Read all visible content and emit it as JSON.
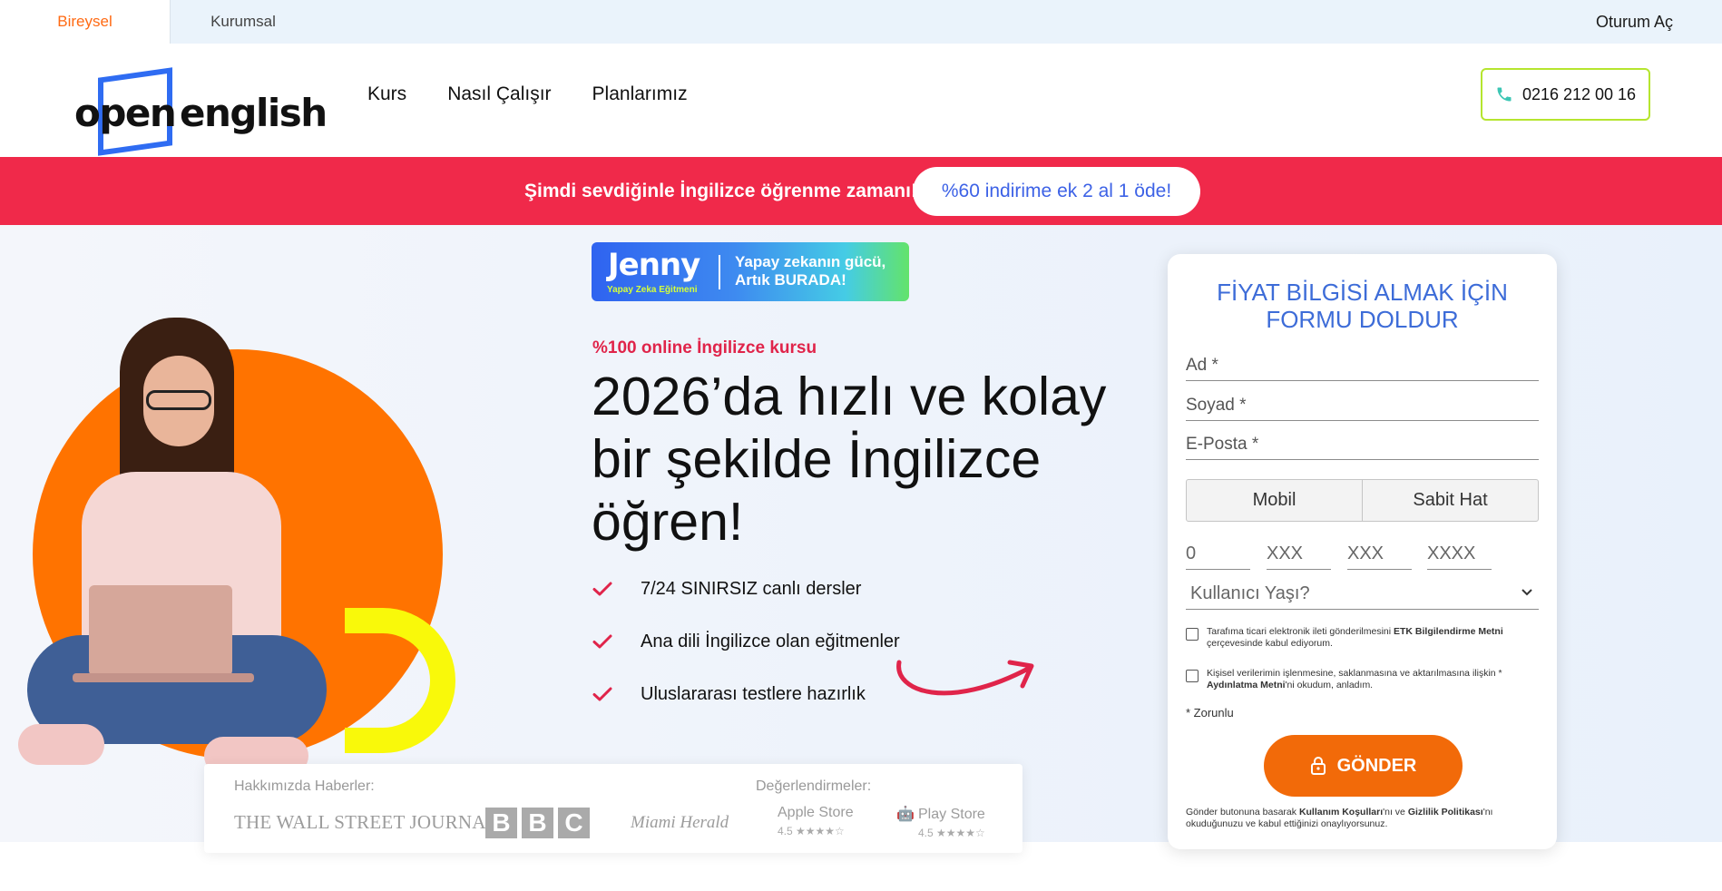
{
  "topbar": {
    "tab_personal": "Bireysel",
    "tab_corporate": "Kurumsal",
    "login": "Oturum Aç"
  },
  "header": {
    "logo_word1": "open",
    "logo_word2": "english",
    "nav": [
      "Kurs",
      "Nasıl Çalışır",
      "Planlarımız"
    ],
    "phone": "0216 212 00 16"
  },
  "promo": {
    "text": "Şimdi sevdiğinle İngilizce öğrenme zamanı!",
    "button": "%60 indirime ek 2 al 1 öde!"
  },
  "hero": {
    "jenny_name": "Jenny",
    "jenny_sub": "Yapay Zeka Eğitmeni",
    "jenny_tagline": "Yapay zekanın gücü, Artık BURADA!",
    "subhead": "%100 online İngilizce kursu",
    "headline": "2026’da hızlı ve kolay bir şekilde İngilizce öğren!",
    "features": [
      "7/24 SINIRSIZ canlı dersler",
      "Ana dili İngilizce olan eğitmenler",
      "Uluslararası testlere hazırlık"
    ]
  },
  "press": {
    "news_label": "Hakkımızda Haberler:",
    "ratings_label": "Değerlendirmeler:",
    "wsj": "THE WALL STREET JOURNAL.",
    "bbc": [
      "B",
      "B",
      "C"
    ],
    "herald": "Miami Herald",
    "apple_store": "Apple Store",
    "apple_rating": "4.5 ★★★★☆",
    "play_store": "Play Store",
    "play_rating": "4.5 ★★★★☆"
  },
  "form": {
    "title": "FİYAT BİLGİSİ ALMAK İÇİN FORMU DOLDUR",
    "first_name": "Ad *",
    "last_name": "Soyad *",
    "email": "E-Posta *",
    "toggle_mobile": "Mobil",
    "toggle_landline": "Sabit Hat",
    "phone_parts": [
      "0",
      "XXX",
      "XXX",
      "XXXX"
    ],
    "age": "Kullanıcı Yaşı?",
    "consent1_pre": "Tarafıma ticari elektronik ileti gönderilmesini ",
    "consent1_bold": "ETK Bilgilendirme Metni",
    "consent1_post": " çerçevesinde kabul ediyorum.",
    "consent2_pre": "Kişisel verilerimin işlenmesine, saklanmasına ve aktarılmasına ilişkin * ",
    "consent2_bold": "Aydınlatma Metni",
    "consent2_post": "'ni okudum, anladım.",
    "required": "* Zorunlu",
    "submit": "GÖNDER",
    "terms_pre": "Gönder butonuna basarak ",
    "terms_bold1": "Kullanım Koşulları",
    "terms_mid": "'nı ve ",
    "terms_bold2": "Gizlilik Politikası",
    "terms_post": "'nı okuduğunuzu ve kabul ettiğinizi onaylıyorsunuz."
  },
  "colors": {
    "accent_orange": "#ff6a13",
    "promo_red": "#f0294a",
    "brand_blue": "#2f6cf2",
    "phone_border": "#b5e52f",
    "submit_orange": "#f26a09"
  }
}
